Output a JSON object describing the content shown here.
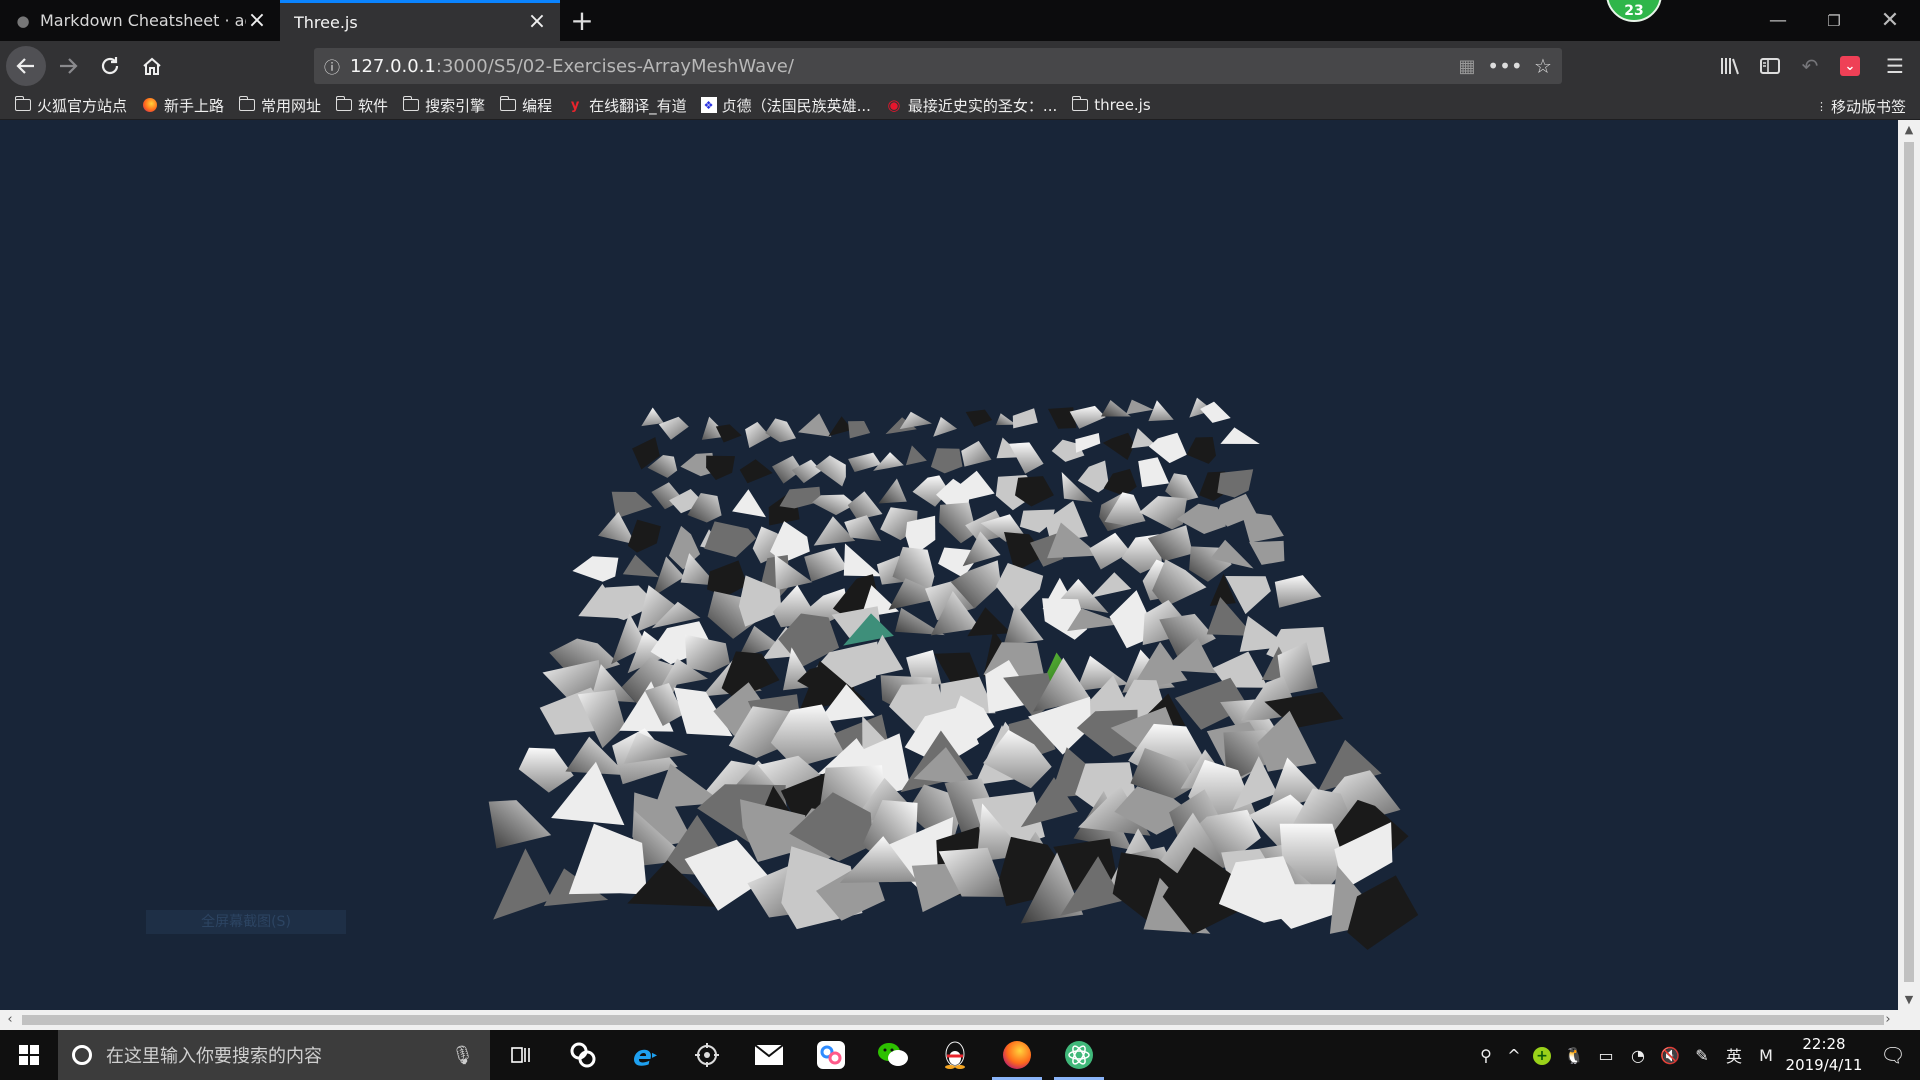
{
  "browser": {
    "tabs": [
      {
        "title": "Markdown Cheatsheet · adam",
        "active": false
      },
      {
        "title": "Three.js",
        "active": true
      }
    ],
    "notification_count": "23",
    "url": {
      "host": "127.0.0.1",
      "path": ":3000/S5/02-Exercises-ArrayMeshWave/"
    },
    "bookmarks": [
      {
        "label": "火狐官方站点",
        "icon": "folder-icon"
      },
      {
        "label": "新手上路",
        "icon": "firefox-icon"
      },
      {
        "label": "常用网址",
        "icon": "folder-icon"
      },
      {
        "label": "软件",
        "icon": "folder-icon"
      },
      {
        "label": "搜索引擎",
        "icon": "folder-icon"
      },
      {
        "label": "编程",
        "icon": "folder-icon"
      },
      {
        "label": "在线翻译_有道",
        "icon": "youdao-icon"
      },
      {
        "label": "贞德（法国民族英雄...",
        "icon": "baidu-icon"
      },
      {
        "label": "最接近史实的圣女：...",
        "icon": "weibo-icon"
      },
      {
        "label": "three.js",
        "icon": "folder-icon"
      }
    ],
    "mobile_bookmarks": "移动版书签"
  },
  "page": {
    "screenshot_button": "全屏幕截图(S)",
    "background_color": "#182538",
    "scene": "array-mesh-wave"
  },
  "taskbar": {
    "search_placeholder": "在这里输入你要搜索的内容",
    "ime_label": "英",
    "ime_mode": "M",
    "time": "22:28",
    "date": "2019/4/11"
  }
}
